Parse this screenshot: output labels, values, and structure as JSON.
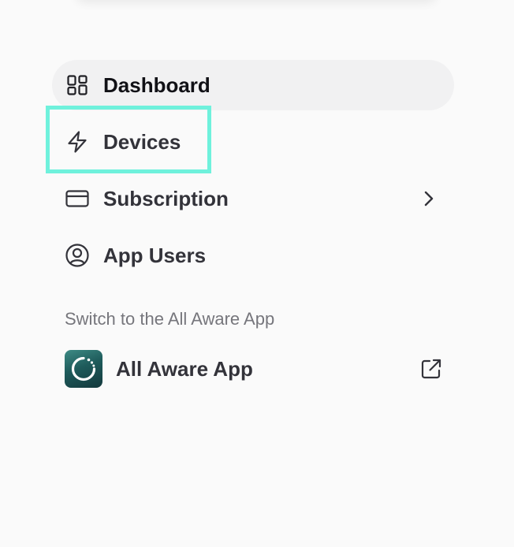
{
  "nav": {
    "items": [
      {
        "label": "Dashboard",
        "icon": "dashboard-grid-icon",
        "active": true
      },
      {
        "label": "Devices",
        "icon": "lightning-bolt-icon",
        "highlighted": true
      },
      {
        "label": "Subscription",
        "icon": "credit-card-icon",
        "has_submenu": true
      },
      {
        "label": "App Users",
        "icon": "user-circle-icon"
      }
    ]
  },
  "switch_section": {
    "label": "Switch to the All Aware App",
    "app_name": "All Aware App",
    "app_icon": "all-aware-logo-icon",
    "link_icon": "external-link-icon"
  },
  "colors": {
    "background": "#fafafa",
    "active_item_bg": "#f1f1f2",
    "highlight": "#6ff1dc",
    "text": "#33333a",
    "muted_text": "#76767c",
    "logo_gradient_start": "#3e8b85",
    "logo_gradient_end": "#14393d"
  }
}
